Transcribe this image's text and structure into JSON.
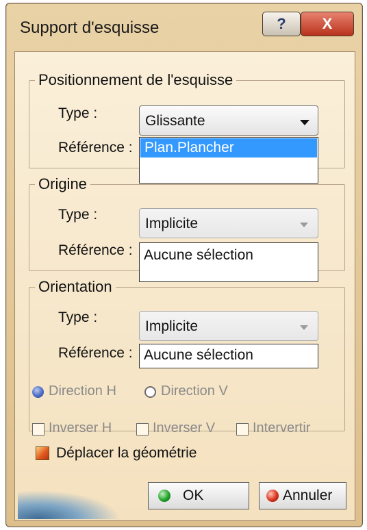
{
  "window": {
    "title": "Support d'esquisse",
    "help_label": "?",
    "close_label": "X"
  },
  "positioning": {
    "legend": "Positionnement de l'esquisse",
    "type_label": "Type :",
    "type_value": "Glissante",
    "reference_label": "Référence :",
    "reference_items": [
      "Plan.Plancher"
    ]
  },
  "origin": {
    "legend": "Origine",
    "type_label": "Type :",
    "type_value": "Implicite",
    "reference_label": "Référence :",
    "reference_value": "Aucune sélection"
  },
  "orientation": {
    "legend": "Orientation",
    "type_label": "Type :",
    "type_value": "Implicite",
    "reference_label": "Référence :",
    "reference_value": "Aucune sélection",
    "direction_h": {
      "label": "Direction H",
      "checked": true
    },
    "direction_v": {
      "label": "Direction V",
      "checked": false
    },
    "invert_h": {
      "label": "Inverser H",
      "checked": false
    },
    "invert_v": {
      "label": "Inverser V",
      "checked": false
    },
    "swap": {
      "label": "Intervertir",
      "checked": false
    }
  },
  "move_geometry": {
    "label": "Déplacer la géométrie",
    "checked": true
  },
  "buttons": {
    "ok": "OK",
    "cancel": "Annuler"
  },
  "colors": {
    "selection": "#3399ff",
    "window_frame": "#ddbf8c",
    "client_bg": "#f4e1bf",
    "close_button": "#b8321d"
  }
}
